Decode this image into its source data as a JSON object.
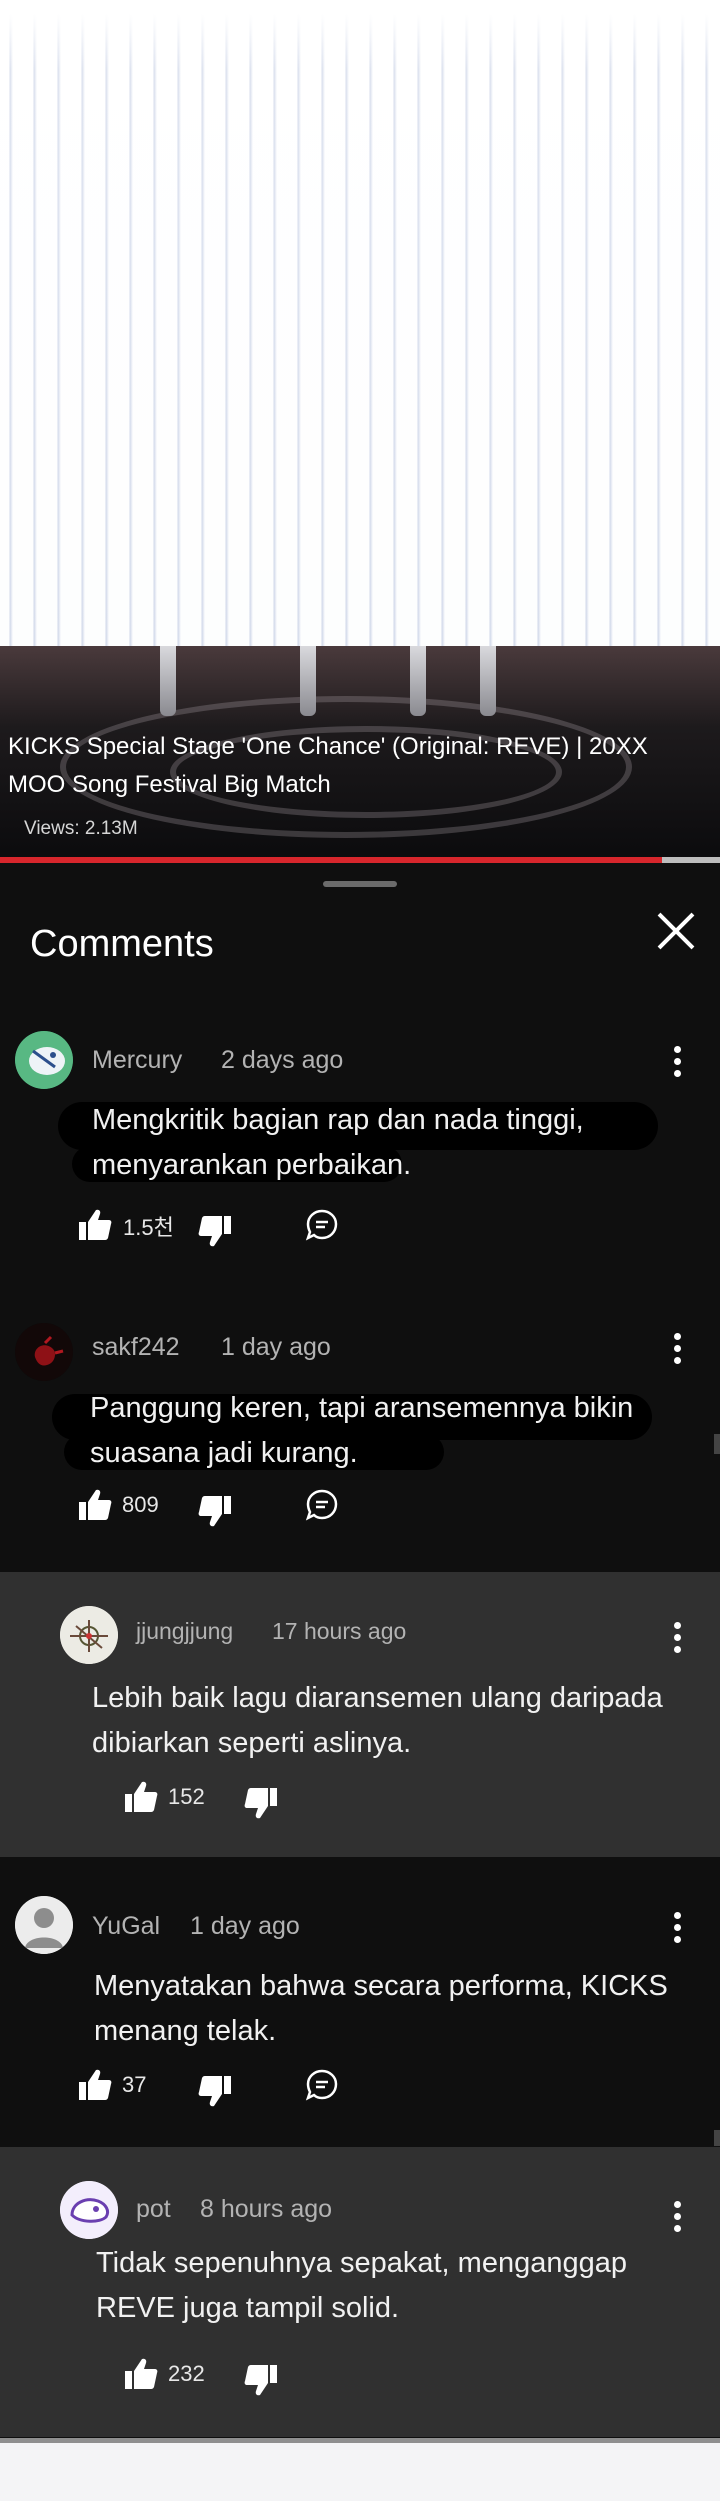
{
  "video": {
    "title": "KICKS Special Stage 'One Chance' (Original: REVE) | 20XX MOO Song Festival Big Match",
    "views": "Views: 2.13M",
    "progress_fraction": 0.92,
    "progress_color": "#d7262c"
  },
  "comments_sheet": {
    "title": "Comments",
    "close_icon": "close-icon"
  },
  "comments": [
    {
      "author": "Mercury",
      "time": "2 days ago",
      "text": "Mengkritik bagian rap dan nada tinggi, menyarankan perbaikan.",
      "likes": "1.5천",
      "has_reply_button": true
    },
    {
      "author": "sakf242",
      "time": "1 day ago",
      "text": "Panggung keren, tapi aransemennya bikin suasana jadi kurang.",
      "likes": "809",
      "has_reply_button": true
    },
    {
      "author": "jjungjjung",
      "time": "17 hours ago",
      "text": "Lebih baik lagu diaransemen ulang daripada dibiarkan seperti aslinya.",
      "likes": "152",
      "has_reply_button": false
    },
    {
      "author": "YuGal",
      "time": "1 day ago",
      "text": "Menyatakan bahwa secara performa, KICKS menang telak.",
      "likes": "37",
      "has_reply_button": true
    },
    {
      "author": "pot",
      "time": "8 hours ago",
      "text": "Tidak sepenuhnya sepakat, menganggap REVE juga tampil solid.",
      "likes": "232",
      "has_reply_button": false
    }
  ]
}
